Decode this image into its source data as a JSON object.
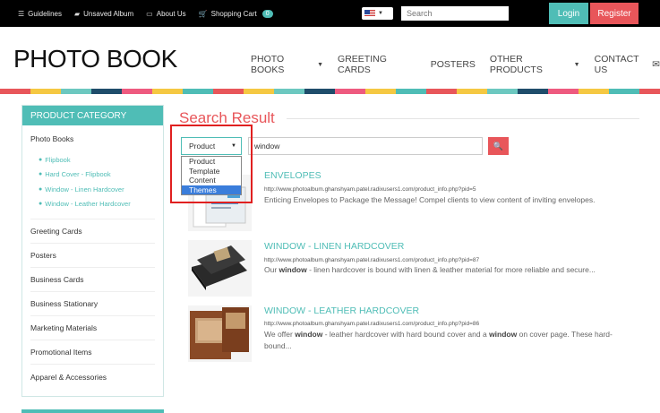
{
  "topbar": {
    "links": [
      {
        "label": "Guidelines",
        "icon": "list-icon"
      },
      {
        "label": "Unsaved Album",
        "icon": "folder-icon"
      },
      {
        "label": "About Us",
        "icon": "card-icon"
      },
      {
        "label": "Shopping Cart",
        "icon": "cart-icon"
      }
    ],
    "cart_count": "0",
    "search_placeholder": "Search",
    "login_label": "Login",
    "register_label": "Register"
  },
  "header": {
    "logo": "PHOTO BOOK",
    "nav": [
      "PHOTO BOOKS",
      "GREETING CARDS",
      "POSTERS",
      "OTHER PRODUCTS",
      "CONTACT US"
    ]
  },
  "sidebar": {
    "title": "PRODUCT CATEGORY",
    "first_category": "Photo Books",
    "sub_items": [
      "Flipbook",
      "Hard Cover - Flipbook",
      "Window - Linen Hardcover",
      "Window - Leather Hardcover"
    ],
    "categories": [
      "Greeting Cards",
      "Posters",
      "Business Cards",
      "Business Stationary",
      "Marketing Materials",
      "Promotional Items",
      "Apparel & Accessories"
    ]
  },
  "search": {
    "title": "Search Result",
    "selected": "Product",
    "options": [
      "Product",
      "Template",
      "Content",
      "Themes"
    ],
    "highlighted_option": "Themes",
    "keyword": "window"
  },
  "results": [
    {
      "title": "ENVELOPES",
      "url": "http://www.photoalbum.ghanshyam.patel.radixusers1.com/product_info.php?pid=5",
      "desc": "Enticing Envelopes to Package the Message! Compel clients to view content of inviting envelopes."
    },
    {
      "title": "WINDOW - LINEN HARDCOVER",
      "url": "http://www.photoalbum.ghanshyam.patel.radixusers1.com/product_info.php?pid=87",
      "desc_pre": "Our ",
      "desc_bold": "window",
      "desc_post": " - linen hardcover is bound with linen & leather material for more reliable and secure..."
    },
    {
      "title": "WINDOW - LEATHER HARDCOVER",
      "url": "http://www.photoalbum.ghanshyam.patel.radixusers1.com/product_info.php?pid=86",
      "desc_pre": "We offer ",
      "desc_bold": "window",
      "desc_mid": " - leather hardcover with hard bound cover and a ",
      "desc_bold2": "window",
      "desc_post": " on cover page. These hard-bound..."
    }
  ]
}
